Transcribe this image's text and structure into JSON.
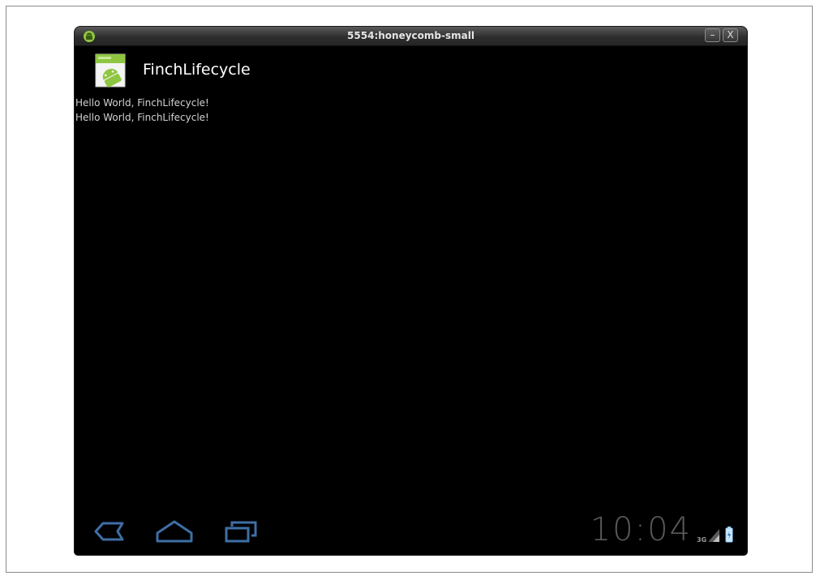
{
  "window": {
    "title": "5554:honeycomb-small",
    "minimize_label": "–",
    "close_label": "X"
  },
  "app": {
    "name": "FinchLifecycle",
    "lines": [
      "Hello World, FinchLifecycle!",
      "Hello World, FinchLifecycle!"
    ]
  },
  "status_bar": {
    "time": "10:04",
    "network": "3G"
  },
  "icons": [
    "android-icon",
    "app-launcher-icon",
    "back-icon",
    "home-icon",
    "recent-apps-icon",
    "signal-icon",
    "battery-icon"
  ],
  "colors": {
    "screen_bg": "#000000",
    "text": "#d2d2d2",
    "clock": "#5a5a5a",
    "android_green": "#8fc641",
    "nav_icon": "#3e6fa6"
  }
}
